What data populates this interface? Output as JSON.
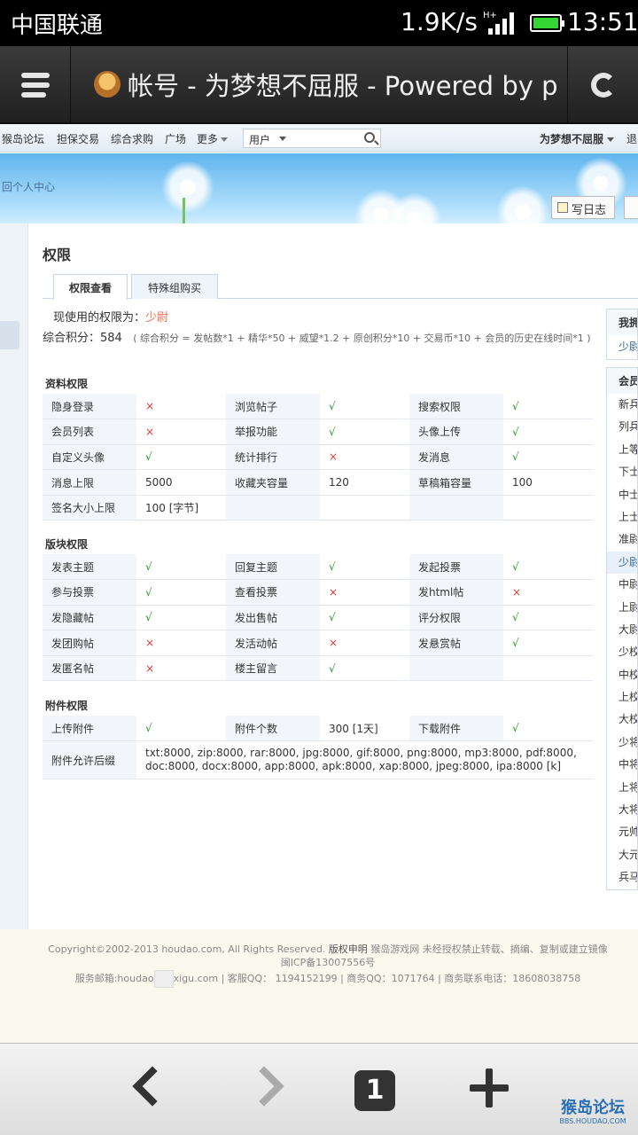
{
  "status_bar": {
    "carrier": "中国联通",
    "speed": "1.9K/s",
    "network": "H+",
    "time": "13:51"
  },
  "browser": {
    "title": "帐号 - 为梦想不屈服 - Powered by p",
    "tab_count": "1"
  },
  "site_nav": {
    "links": [
      "猴岛论坛",
      "担保交易",
      "综合求购",
      "广场",
      "更多"
    ],
    "search_select": "用户",
    "username": "为梦想不屈服",
    "logout": "退"
  },
  "banner": {
    "back_link": "回个人中心",
    "write_blog": "写日志"
  },
  "page": {
    "title": "权限",
    "tabs": [
      "权限查看",
      "特殊组购买"
    ],
    "current_label": "现使用的权限为：",
    "current_rank": "少尉",
    "credits_label": "综合积分：584",
    "credits_formula": "( 综合积分 = 发帖数*1 + 精华*50 + 威望*1.2 + 原创积分*10 + 交易币*10 + 会员的历史在线时间*1 )"
  },
  "sections": [
    {
      "title": "资料权限",
      "rows": [
        [
          {
            "k": "隐身登录",
            "v": "×",
            "s": "no"
          },
          {
            "k": "浏览帖子",
            "v": "√",
            "s": "yes"
          },
          {
            "k": "搜索权限",
            "v": "√",
            "s": "yes"
          }
        ],
        [
          {
            "k": "会员列表",
            "v": "×",
            "s": "no"
          },
          {
            "k": "举报功能",
            "v": "√",
            "s": "yes"
          },
          {
            "k": "头像上传",
            "v": "√",
            "s": "yes"
          }
        ],
        [
          {
            "k": "自定义头像",
            "v": "√",
            "s": "yes"
          },
          {
            "k": "统计排行",
            "v": "×",
            "s": "no"
          },
          {
            "k": "发消息",
            "v": "√",
            "s": "yes"
          }
        ],
        [
          {
            "k": "消息上限",
            "v": "5000",
            "s": ""
          },
          {
            "k": "收藏夹容量",
            "v": "120",
            "s": ""
          },
          {
            "k": "草稿箱容量",
            "v": "100",
            "s": ""
          }
        ],
        [
          {
            "k": "签名大小上限",
            "v": "100 [字节]",
            "s": ""
          },
          {
            "k": "",
            "v": "",
            "s": ""
          },
          {
            "k": "",
            "v": "",
            "s": ""
          }
        ]
      ]
    },
    {
      "title": "版块权限",
      "rows": [
        [
          {
            "k": "发表主题",
            "v": "√",
            "s": "yes"
          },
          {
            "k": "回复主题",
            "v": "√",
            "s": "yes"
          },
          {
            "k": "发起投票",
            "v": "√",
            "s": "yes"
          }
        ],
        [
          {
            "k": "参与投票",
            "v": "√",
            "s": "yes"
          },
          {
            "k": "查看投票",
            "v": "×",
            "s": "no"
          },
          {
            "k": "发html帖",
            "v": "×",
            "s": "no"
          }
        ],
        [
          {
            "k": "发隐藏帖",
            "v": "√",
            "s": "yes"
          },
          {
            "k": "发出售帖",
            "v": "√",
            "s": "yes"
          },
          {
            "k": "评分权限",
            "v": "√",
            "s": "yes"
          }
        ],
        [
          {
            "k": "发团购帖",
            "v": "×",
            "s": "no"
          },
          {
            "k": "发活动帖",
            "v": "×",
            "s": "no"
          },
          {
            "k": "发悬赏帖",
            "v": "√",
            "s": "yes"
          }
        ],
        [
          {
            "k": "发匿名帖",
            "v": "×",
            "s": "no"
          },
          {
            "k": "楼主留言",
            "v": "√",
            "s": "yes"
          },
          {
            "k": "",
            "v": "",
            "s": ""
          }
        ]
      ]
    },
    {
      "title": "附件权限",
      "rows": [
        [
          {
            "k": "上传附件",
            "v": "√",
            "s": "yes"
          },
          {
            "k": "附件个数",
            "v": "300 [1天]",
            "s": ""
          },
          {
            "k": "下载附件",
            "v": "√",
            "s": "yes"
          }
        ]
      ],
      "ext_label": "附件允许后缀",
      "ext_value": "txt:8000, zip:8000, rar:8000, jpg:8000, gif:8000, png:8000, mp3:8000, pdf:8000, doc:8000, docx:8000, app:8000, apk:8000, xap:8000, jpeg:8000, ipa:8000 [k]"
    }
  ],
  "sidebar": {
    "box1_title": "我拥",
    "box1_link": "少尉",
    "box2_title": "会员",
    "groups": [
      "新兵",
      "列兵",
      "上等",
      "下士",
      "中士",
      "上士",
      "准尉",
      "少尉",
      "中尉",
      "上尉",
      "大尉",
      "少校",
      "中校",
      "上校",
      "大校",
      "少将",
      "中将",
      "上将",
      "大将",
      "元帅",
      "大元",
      "兵马"
    ],
    "current_group": "少尉"
  },
  "footer": {
    "copyright": "Copyright©2002-2013 houdao.com, All Rights Reserved.",
    "notice_label": "版权申明",
    "notice": "猴岛游戏网 未经授权禁止转载、摘编、复制或建立镜像",
    "icp": "闽ICP备13007556号",
    "service_prefix": "服务邮箱:houdao",
    "service_rest": "xigu.com | 客服QQ： 1194152199 | 商务QQ：1071764 | 商务联系电话：18608038758"
  },
  "watermark": {
    "text": "猴岛论坛",
    "sub": "BBS.HOUDAO.COM"
  },
  "colors": {
    "accent": "#f26c4f",
    "yes": "#1f9a1f",
    "no": "#e03a3a"
  }
}
